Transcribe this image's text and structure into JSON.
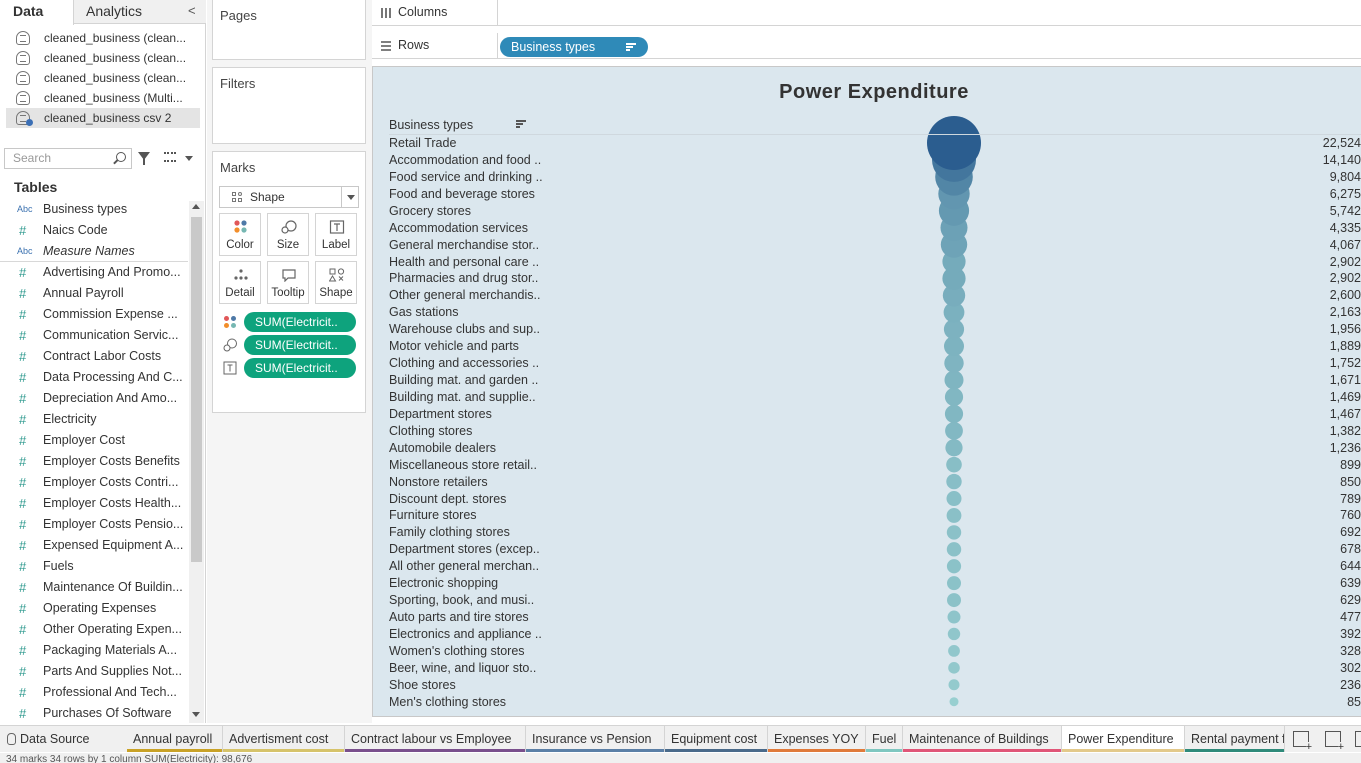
{
  "left_pane": {
    "tabs": {
      "data": "Data",
      "analytics": "Analytics"
    },
    "collapse_glyph": "<",
    "data_sources": [
      "cleaned_business (clean...",
      "cleaned_business (clean...",
      "cleaned_business (clean...",
      "cleaned_business (Multi...",
      "cleaned_business csv 2"
    ],
    "active_data_source_index": 4,
    "search_placeholder": "Search",
    "tables_header": "Tables",
    "fields": [
      {
        "type": "Abc",
        "name": "Business types"
      },
      {
        "type": "#",
        "name": "Naics Code"
      },
      {
        "type": "Abc",
        "name": "Measure Names",
        "italic": true
      },
      {
        "type": "#",
        "name": "Advertising And Promo..."
      },
      {
        "type": "#",
        "name": "Annual Payroll"
      },
      {
        "type": "#",
        "name": "Commission Expense ..."
      },
      {
        "type": "#",
        "name": "Communication Servic..."
      },
      {
        "type": "#",
        "name": "Contract Labor Costs"
      },
      {
        "type": "#",
        "name": "Data Processing And C..."
      },
      {
        "type": "#",
        "name": "Depreciation And Amo..."
      },
      {
        "type": "#",
        "name": "Electricity"
      },
      {
        "type": "#",
        "name": "Employer Cost"
      },
      {
        "type": "#",
        "name": "Employer Costs Benefits"
      },
      {
        "type": "#",
        "name": "Employer Costs Contri..."
      },
      {
        "type": "#",
        "name": "Employer Costs Health..."
      },
      {
        "type": "#",
        "name": "Employer Costs Pensio..."
      },
      {
        "type": "#",
        "name": "Expensed Equipment A..."
      },
      {
        "type": "#",
        "name": "Fuels"
      },
      {
        "type": "#",
        "name": "Maintenance Of Buildin..."
      },
      {
        "type": "#",
        "name": "Operating Expenses"
      },
      {
        "type": "#",
        "name": "Other Operating Expen..."
      },
      {
        "type": "#",
        "name": "Packaging Materials A..."
      },
      {
        "type": "#",
        "name": "Parts And Supplies Not..."
      },
      {
        "type": "#",
        "name": "Professional And Tech..."
      },
      {
        "type": "#",
        "name": "Purchases Of Software"
      }
    ]
  },
  "cards": {
    "pages": "Pages",
    "filters": "Filters",
    "marks": "Marks",
    "mark_type": "Shape",
    "mark_buttons": [
      "Color",
      "Size",
      "Label",
      "Detail",
      "Tooltip",
      "Shape"
    ],
    "mark_pills": [
      "SUM(Electricit..",
      "SUM(Electricit..",
      "SUM(Electricit.."
    ]
  },
  "shelves": {
    "columns_label": "Columns",
    "rows_label": "Rows",
    "rows_pill": "Business types"
  },
  "colors": {
    "pill_green": "#0ea37d",
    "pill_blue": "#2f8ab8",
    "viz_bg": "#dbe7ee",
    "bubble_dark": "#2b5d8f",
    "bubble_light": "#9fd6d4"
  },
  "chart_data": {
    "type": "scatter",
    "title": "Power  Expenditure",
    "row_header": "Business types",
    "categories": [
      "Retail Trade",
      "Accommodation and food ..",
      "Food service and drinking ..",
      "Food and beverage stores",
      "Grocery stores",
      "Accommodation services",
      "General merchandise stor..",
      "Health and personal care ..",
      "Pharmacies and drug stor..",
      "Other general merchandis..",
      "Gas stations",
      "Warehouse clubs and sup..",
      "Motor vehicle and parts",
      "Clothing and accessories ..",
      "Building mat. and garden ..",
      "Building mat. and supplie..",
      "Department stores",
      "Clothing stores",
      "Automobile dealers",
      "Miscellaneous store retail..",
      "Nonstore retailers",
      "Discount dept. stores",
      "Furniture stores",
      "Family clothing stores",
      "Department stores (excep..",
      "All other general merchan..",
      "Electronic shopping",
      "Sporting, book, and  musi..",
      "Auto parts and tire stores",
      "Electronics and appliance ..",
      "Women's clothing stores",
      "Beer, wine, and liquor sto..",
      "Shoe stores",
      "Men's clothing stores"
    ],
    "value_labels": [
      "22,524",
      "14,140",
      "9,804",
      "6,275",
      "5,742",
      "4,335",
      "4,067",
      "2,902",
      "2,902",
      "2,600",
      "2,163",
      "1,956",
      "1,889",
      "1,752",
      "1,671",
      "1,469",
      "1,467",
      "1,382",
      "1,236",
      "899",
      "850",
      "789",
      "760",
      "692",
      "678",
      "644",
      "639",
      "629",
      "477",
      "392",
      "328",
      "302",
      "236",
      "85"
    ],
    "values": [
      22524,
      14140,
      9804,
      6275,
      5742,
      4335,
      4067,
      2902,
      2902,
      2600,
      2163,
      1956,
      1889,
      1752,
      1671,
      1469,
      1467,
      1382,
      1236,
      899,
      850,
      789,
      760,
      692,
      678,
      644,
      639,
      629,
      477,
      392,
      328,
      302,
      236,
      85
    ],
    "encoding": "color and size by SUM(Electricity)"
  },
  "bottom_tabs": {
    "data_source": "Data Source",
    "sheets": [
      {
        "label": "Annual payroll",
        "color": "#c9a227"
      },
      {
        "label": "Advertisment  cost",
        "color": "#d6c36a"
      },
      {
        "label": "Contract  labour vs Employee",
        "color": "#7a4f8c"
      },
      {
        "label": "Insurance  vs  Pension",
        "color": "#5b7fa6"
      },
      {
        "label": "Equipment cost",
        "color": "#4a6a8a"
      },
      {
        "label": "Expenses  YOY",
        "color": "#e07a3a"
      },
      {
        "label": "Fuel",
        "color": "#7fc7c0"
      },
      {
        "label": "Maintenance of Buildings",
        "color": "#e05577"
      },
      {
        "label": "Power  Expenditure",
        "color": "#e3c98a",
        "active": true
      },
      {
        "label": "Rental payment f",
        "color": "#2f8a7a"
      }
    ]
  },
  "status_bar": "34 marks    34 rows by 1 column    SUM(Electricity): 98,676"
}
